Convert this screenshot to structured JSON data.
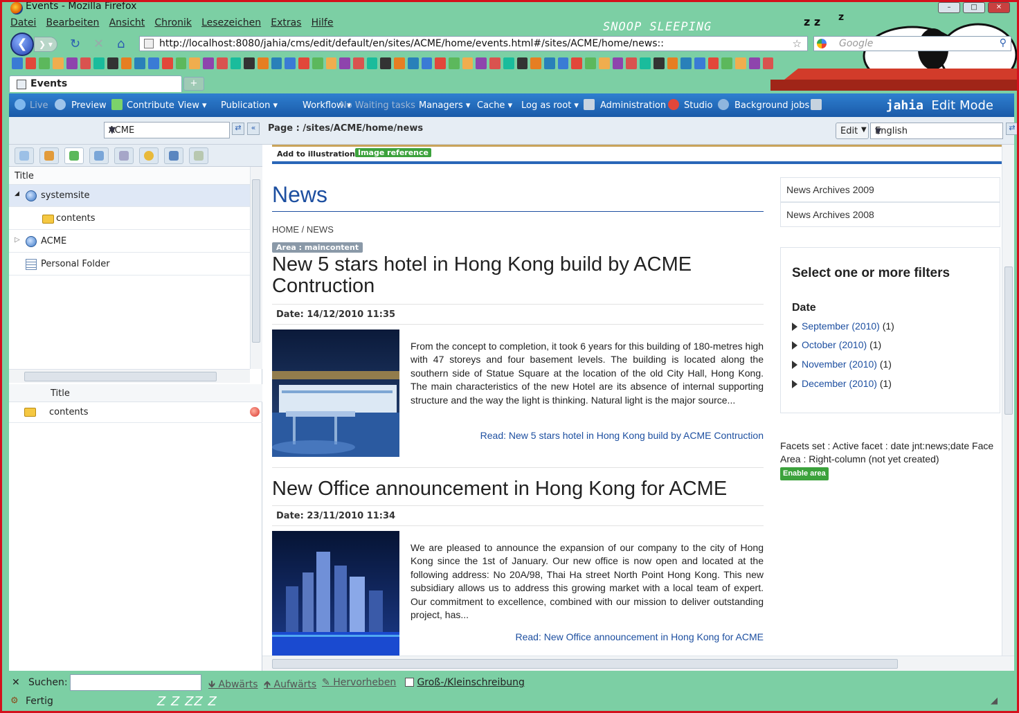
{
  "window": {
    "title": "Events - Mozilla Firefox",
    "menu": [
      "Datei",
      "Bearbeiten",
      "Ansicht",
      "Chronik",
      "Lesezeichen",
      "Extras",
      "Hilfe"
    ],
    "theme_text": "SNOOP SLEEPING",
    "theme_zzz": "zzz"
  },
  "nav": {
    "url": "http://localhost:8080/jahia/cms/edit/default/en/sites/ACME/home/events.html#/sites/ACME/home/news::",
    "search_placeholder": "Google"
  },
  "tabs": [
    {
      "label": "Events"
    }
  ],
  "toolbar": {
    "live": "Live",
    "preview": "Preview",
    "contribute": "Contribute",
    "view": "View",
    "publication": "Publication",
    "workflow": "Workflow",
    "no_waiting": "No Waiting tasks",
    "managers": "Managers",
    "cache": "Cache",
    "log_as_root": "Log as root",
    "administration": "Administration",
    "studio": "Studio",
    "background_jobs": "Background jobs",
    "brand": "jahia",
    "mode": "Edit Mode"
  },
  "left": {
    "site": "ACME",
    "tree_header": "Title",
    "tree": [
      {
        "label": "systemsite"
      },
      {
        "label": "contents"
      },
      {
        "label": "ACME"
      },
      {
        "label": "Personal Folder"
      }
    ],
    "grid_header": "Title",
    "grid_rows": [
      {
        "label": "contents"
      }
    ]
  },
  "main": {
    "page_path": "Page : /sites/ACME/home/news",
    "edit": "Edit",
    "language": "English",
    "add_illustration": "Add to illustration :",
    "image_reference": "Image reference",
    "title": "News",
    "breadcrumb": [
      "HOME",
      "NEWS"
    ],
    "area_badge": "Area : maincontent",
    "articles": [
      {
        "title": "New 5 stars hotel in Hong Kong build by ACME Contruction",
        "date": "Date: 14/12/2010  11:35",
        "text": "From the concept to completion, it took 6 years for this building of 180-metres high with 47 storeys and four basement levels. The building is located along the southern side of Statue Square at the location of the old City Hall, Hong Kong. The main characteristics of the new Hotel are its absence of internal supporting structure and the way the light is thinking. Natural light is the major source...",
        "read": "Read: New 5 stars hotel in Hong Kong build by ACME Contruction"
      },
      {
        "title": "New Office announcement in Hong Kong for ACME",
        "date": "Date: 23/11/2010  11:34",
        "text": "We are pleased to announce the expansion of our company to the city of Hong Kong since the 1st of January. Our new office is now open and located at the following address: No 20A/98, Thai Ha street North Point Hong Kong. This new subsidiary allows us to address this growing market with a local team of expert. Our commitment to excellence, combined with our mission to deliver outstanding project, has...",
        "read": "Read: New Office announcement in Hong Kong for ACME"
      }
    ]
  },
  "right": {
    "archives": [
      "News Archives 2009",
      "News Archives 2008"
    ],
    "filter_title": "Select one or more filters",
    "date_label": "Date",
    "filters": [
      {
        "label": "September (2010)",
        "count": "(1)"
      },
      {
        "label": "October (2010)",
        "count": "(1)"
      },
      {
        "label": "November (2010)",
        "count": "(1)"
      },
      {
        "label": "December (2010)",
        "count": "(1)"
      }
    ],
    "facets_line1": "Facets set : Active facet : date jnt:news;date Face",
    "facets_line2": "Area : Right-column (not yet created)",
    "enable_area": "Enable area"
  },
  "findbar": {
    "label": "Suchen:",
    "down": "Abwärts",
    "up": "Aufwärts",
    "highlight": "Hervorheben",
    "case": "Groß-/Kleinschreibung"
  },
  "status": {
    "text": "Fertig",
    "zzz": "Z Z ZZ Z"
  }
}
